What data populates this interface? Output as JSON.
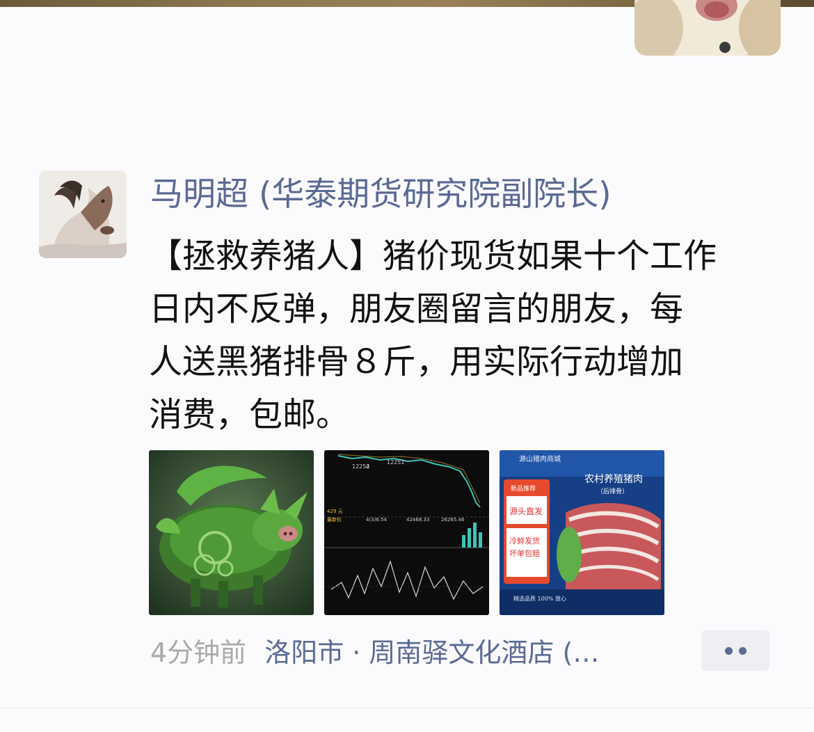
{
  "post": {
    "author": "马明超 (华泰期货研究院副院长)",
    "text_lines": [
      "【拯救养猪人】猪价现货如果十个工作",
      "日内不反弹，朋友圈留言的朋友，每",
      "人送黑猪排骨８斤，用实际行动增加",
      "消费，包邮。"
    ],
    "time": "4分钟前",
    "location": "洛阳市 · 周南驿文化酒店 (…"
  },
  "images": {
    "chart_labels": [
      "12252",
      "4",
      "12251",
      "429 元",
      "最新价",
      "42468.33",
      "26265.46",
      "4(3)6.54"
    ],
    "ad": {
      "top_text": "源山猪肉商城",
      "title": "农村养殖猪肉",
      "title_sub": "（后排骨）",
      "tag": "新品推荐",
      "badge_1": "源头直发",
      "badge_2": "冷鲜发货",
      "badge_3": "坏单包赔",
      "footer": "精选品质 100% 放心"
    }
  },
  "colors": {
    "link": "#5a6a94",
    "time": "#a9a9a9",
    "text": "#111111"
  },
  "icons": {
    "more": "dots-icon"
  }
}
